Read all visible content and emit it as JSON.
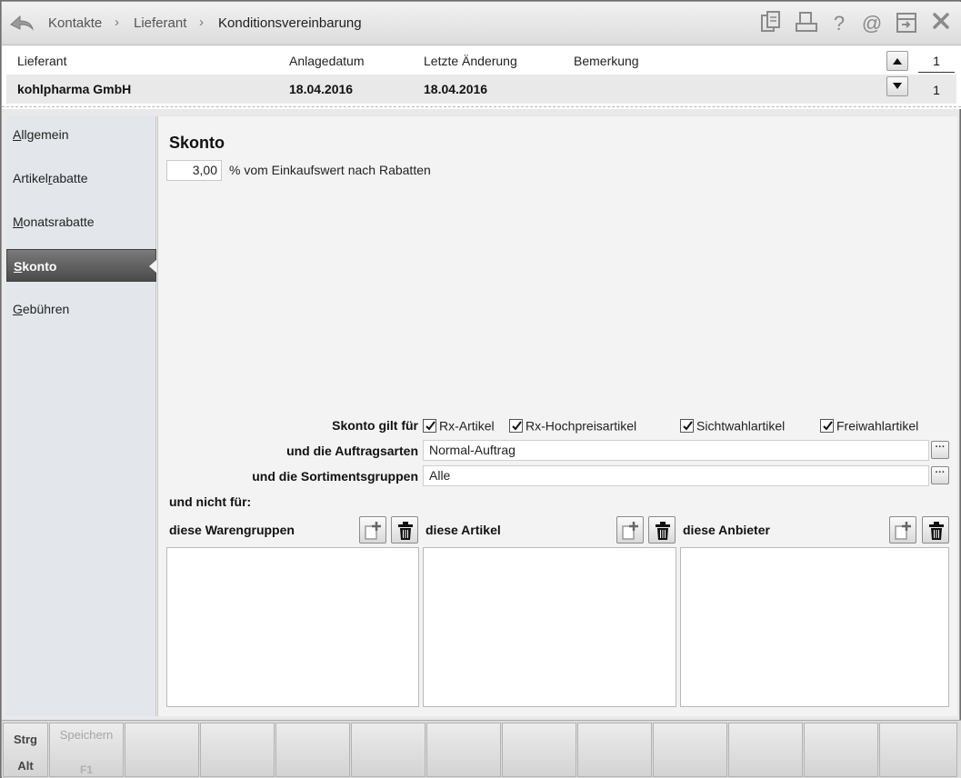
{
  "breadcrumb": [
    "Kontakte",
    "Lieferant",
    "Konditionsvereinbarung"
  ],
  "header": {
    "col_supplier": "Lieferant",
    "col_created": "Anlagedatum",
    "col_modified": "Letzte Änderung",
    "col_remark": "Bemerkung",
    "supplier": "kohlpharma GmbH",
    "created": "18.04.2016",
    "modified": "18.04.2016",
    "remark": "",
    "page_current": "1",
    "page_total": "1"
  },
  "sidebar": {
    "items": [
      {
        "prefix": "",
        "ul": "A",
        "rest": "llgemein"
      },
      {
        "prefix": "Artikel",
        "ul": "r",
        "rest": "abatte"
      },
      {
        "prefix": "",
        "ul": "M",
        "rest": "onatsrabatte"
      },
      {
        "prefix": "",
        "ul": "S",
        "rest": "konto"
      },
      {
        "prefix": "",
        "ul": "G",
        "rest": "ebühren"
      }
    ],
    "active_index": 3
  },
  "main": {
    "title": "Skonto",
    "skonto_value": "3,00",
    "skonto_suffix": "% vom Einkaufswert nach Rabatten",
    "applies_label": "Skonto gilt für",
    "checkboxes": [
      {
        "label": "Rx-Artikel",
        "checked": true
      },
      {
        "label": "Rx-Hochpreisartikel",
        "checked": true
      },
      {
        "label": "Sichtwahlartikel",
        "checked": true
      },
      {
        "label": "Freiwahlartikel",
        "checked": true
      }
    ],
    "order_types_label": "und die Auftragsarten",
    "order_types_value": "Normal-Auftrag",
    "assortment_label": "und die Sortimentsgruppen",
    "assortment_value": "Alle",
    "dots_label": "···",
    "not_for_label": "und nicht für:",
    "lists": [
      {
        "title": "diese Warengruppen"
      },
      {
        "title": "diese Artikel"
      },
      {
        "title": "diese Anbieter"
      }
    ]
  },
  "footer": {
    "mod_strg": "Strg",
    "mod_alt": "Alt",
    "save_label": "Speichern",
    "save_key": "F1"
  },
  "colors": {
    "active_nav": "#5a5a5a",
    "sidebar_bg": "#e3e6ea",
    "content_bg": "#f3f3f3"
  }
}
